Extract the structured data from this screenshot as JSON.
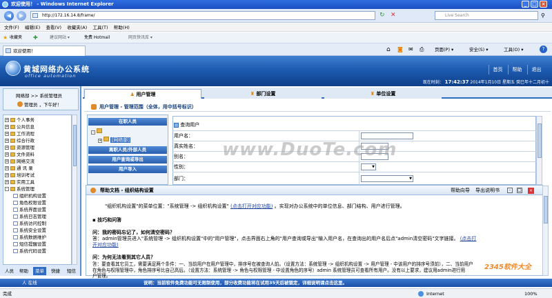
{
  "browser": {
    "title": "欢迎使用！ - Windows Internet Explorer",
    "url": "http://172.16.14.8/frame/",
    "search_placeholder": "Live Search",
    "menu": [
      "文件(F)",
      "编辑(E)",
      "查看(V)",
      "收藏夹(A)",
      "工具(T)",
      "帮助(H)"
    ],
    "favorites_label": "收藏夹",
    "favorites_items": [
      "建议网站 ▾",
      "免费 Hotmail",
      "网页快讯库 ▾"
    ],
    "tab_label": "欢迎使用！",
    "commands": [
      "页面(P) ▾",
      "安全(S) ▾",
      "工具(O) ▾"
    ],
    "status_zone": "Internet",
    "zoom": "100%"
  },
  "app": {
    "logo_title": "黄城网络办公系统",
    "logo_subtitle": "office automation",
    "header_buttons": [
      "首页",
      "帮助",
      "退出"
    ],
    "status_line_prefix": "现在时刻：",
    "time": "17:42:37",
    "date": "2014年1月10日",
    "weekday": "星期五",
    "lunar": "癸巳年十二月初十"
  },
  "sidebar": {
    "dept_path": "网络部 >> 系统管理员",
    "greeting": "管理员 ，下午好！",
    "tree": [
      {
        "label": "个人事务",
        "expander": "+",
        "level": 0
      },
      {
        "label": "公共信息",
        "expander": "+",
        "level": 0
      },
      {
        "label": "工作流程",
        "expander": "+",
        "level": 0
      },
      {
        "label": "综合行政",
        "expander": "+",
        "level": 0
      },
      {
        "label": "资源管理",
        "expander": "+",
        "level": 0
      },
      {
        "label": "文件资料",
        "expander": "+",
        "level": 0
      },
      {
        "label": "网络交流",
        "expander": "+",
        "level": 0
      },
      {
        "label": "通 讯 录",
        "expander": "+",
        "level": 0
      },
      {
        "label": "培训考试",
        "expander": "+",
        "level": 0
      },
      {
        "label": "实用工具",
        "expander": "+",
        "level": 0
      },
      {
        "label": "系统管理",
        "expander": "-",
        "level": 0
      },
      {
        "label": "组织机构设置",
        "expander": "",
        "level": 1
      },
      {
        "label": "角色权限设置",
        "expander": "",
        "level": 1
      },
      {
        "label": "系统界面设置",
        "expander": "",
        "level": 1
      },
      {
        "label": "系统日志管理",
        "expander": "",
        "level": 1
      },
      {
        "label": "系统访问控制",
        "expander": "",
        "level": 1
      },
      {
        "label": "系统安全设置",
        "expander": "",
        "level": 1
      },
      {
        "label": "系统数据维护",
        "expander": "",
        "level": 1
      },
      {
        "label": "短信提醒设置",
        "expander": "",
        "level": 1
      },
      {
        "label": "系统代码设置",
        "expander": "",
        "level": 1
      }
    ],
    "bottom_tabs": [
      "人员",
      "帮助",
      "菜单",
      "快捷",
      "短信"
    ],
    "active_tab": "菜单"
  },
  "module_tabs": [
    "用户管理",
    "部门设置",
    "单位设置"
  ],
  "breadcrumb": "用户管理 - 管理范围（全体，用中括号标识）",
  "org_panel": {
    "dept_node": "[网络部]",
    "buttons": [
      "在职人员",
      "离职人员/外部人员",
      "用户查询或导出",
      "用户导入"
    ]
  },
  "query": {
    "title": "查询用户",
    "fields": [
      "用户名：",
      "真实姓名：",
      "别名：",
      "性别：",
      "部门："
    ]
  },
  "help": {
    "title": "帮助文档 - 组织结构设置",
    "actions": [
      "帮助向导",
      "导出说明书"
    ],
    "p1": "\"组织机构设置\"的菜单位置：\"系统管理 -> 组织机构设置\"",
    "p1_link": "(点击打开对应功能)",
    "p1_tail": "。实现对办公系统中的单位信息、部门结构、用户进行管理。",
    "section": "技巧和问答",
    "q1": "问：我的密码忘记了，如何清空密码？",
    "a1_line1": "答：admin管理员进入\"系统管理 -> 组织机构设置\"中的\"用户管理\"，点击界面右上角的\"用户查询或导出\"输入用户名，在查询出的用户名后点\"admin清空密码\"文字链接。",
    "a1_link_part1": "(点击打",
    "a1_link_part2": "开对应功能)",
    "q2": "问：为何无法看到其它人员？",
    "a2_line1": "答：要查看其它员工，需要满足两个条件：一、当前用户在用户管理中，排序号在被查询人前。（设置方法：系统管理 -> 组织机构设置 -> 用户管理 - 中该用户的排序号须前），二、当前用户",
    "a2_line2": "在角色与权限管理中，角色排序号比自己高后。（设置方法：系统管理 -> 角色与权限管理 - 中设置角色的序号）admin 系统管理员可查看所有用户。没有以上要求，建议用admin进行用",
    "a2_line3": "户管理。"
  },
  "footer": {
    "online": "人 在线",
    "notice": "说明：当前软件免费功能可无限制使用，部分收费功能将在试用35天后被锁定，详细说明请点击这里。"
  },
  "watermarks": [
    "www.DuoTe.com",
    "2345软件大全"
  ]
}
